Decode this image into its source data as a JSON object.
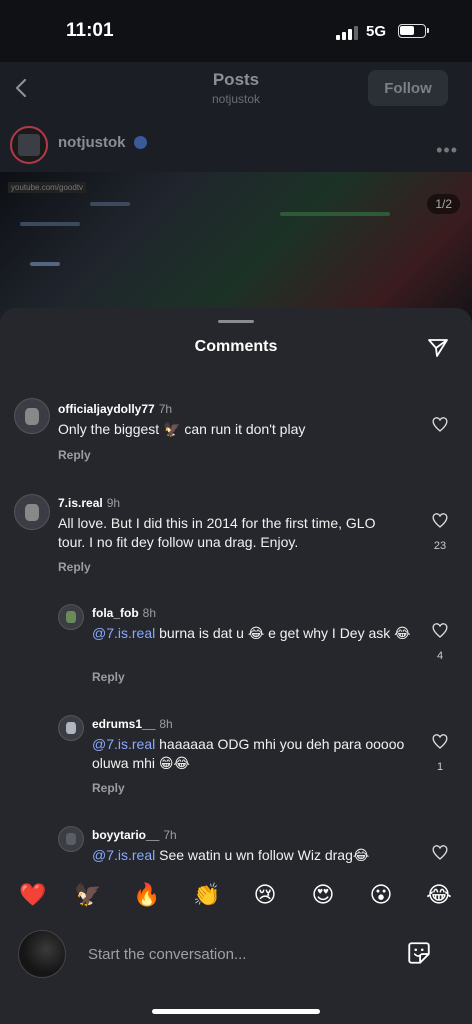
{
  "status_bar": {
    "time": "11:01",
    "network": "5G"
  },
  "header": {
    "title": "Posts",
    "subtitle": "notjustok",
    "follow_label": "Follow"
  },
  "post": {
    "username": "notjustok",
    "image_counter": "1/2",
    "image_watermark": "youtube.com/goodtv"
  },
  "sheet": {
    "title": "Comments"
  },
  "comments": [
    {
      "user": "officialjaydolly77",
      "time": "7h",
      "mention": "",
      "text": "Only the biggest 🦅 can run it don't play",
      "reply": "Reply",
      "likes": ""
    },
    {
      "user": "7.is.real",
      "time": "9h",
      "mention": "",
      "text": "All love. But I did this in 2014 for the first time, GLO tour.  I no fit dey follow una drag. Enjoy.",
      "reply": "Reply",
      "likes": "23"
    },
    {
      "user": "fola_fob",
      "time": "8h",
      "mention": "@7.is.real",
      "text": " burna is dat u 😂 e get why I Dey ask 😂",
      "reply": "Reply",
      "likes": "4"
    },
    {
      "user": "edrums1__",
      "time": "8h",
      "mention": "@7.is.real",
      "text": " haaaaaa ODG mhi you deh para ooooo oluwa mhi 😁😂",
      "reply": "Reply",
      "likes": "1"
    },
    {
      "user": "boyytario__",
      "time": "7h",
      "mention": "@7.is.real",
      "text": " See watin u wn follow Wiz drag😂",
      "reply": "",
      "likes": ""
    }
  ],
  "emojis": [
    "❤️",
    "🦅",
    "🔥",
    "👏",
    "😢",
    "😍",
    "😮",
    "😂"
  ],
  "composer": {
    "placeholder": "Start the conversation..."
  }
}
